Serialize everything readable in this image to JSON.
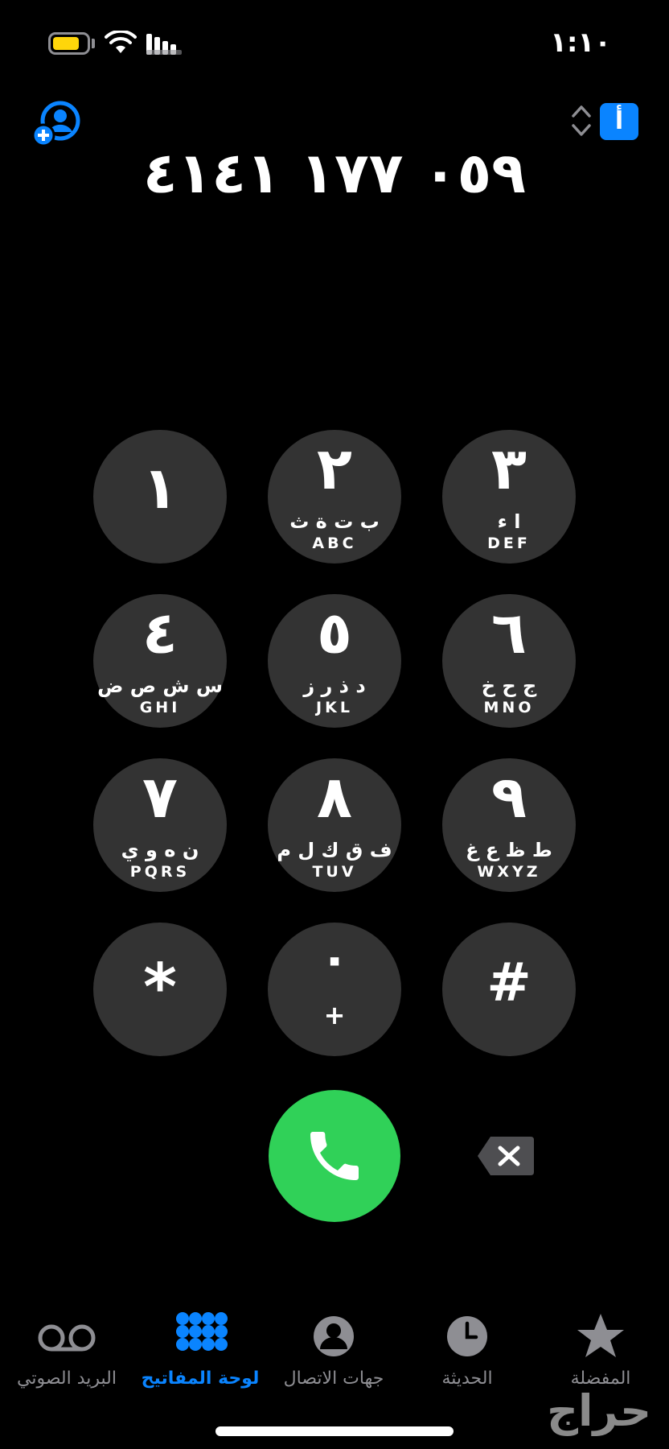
{
  "status_bar": {
    "time": "١:١٠",
    "battery_level": 0.8,
    "battery_color": "#ffd60a"
  },
  "header": {
    "add_contact_icon": "person-plus-icon",
    "keyboard_toggle_icon": "chevron-up-down-icon",
    "language_badge": "أ",
    "dialed_number": "٠٥٩ ١٧٧ ٤١٤١"
  },
  "keypad": {
    "keys": [
      {
        "digit": "١",
        "arabic": "",
        "latin": ""
      },
      {
        "digit": "٢",
        "arabic": "ب ت ة ث",
        "latin": "ABC"
      },
      {
        "digit": "٣",
        "arabic": "ا ء",
        "latin": "DEF"
      },
      {
        "digit": "٤",
        "arabic": "س ش ص ض",
        "latin": "GHI"
      },
      {
        "digit": "٥",
        "arabic": "د ذ ر ز",
        "latin": "JKL"
      },
      {
        "digit": "٦",
        "arabic": "ج ح خ",
        "latin": "MNO"
      },
      {
        "digit": "٧",
        "arabic": "ن ه و ي",
        "latin": "PQRS"
      },
      {
        "digit": "٨",
        "arabic": "ف ق ك ل م",
        "latin": "TUV"
      },
      {
        "digit": "٩",
        "arabic": "ط ظ ع غ",
        "latin": "WXYZ"
      },
      {
        "digit": "*",
        "arabic": "",
        "latin": ""
      },
      {
        "digit": "٠",
        "arabic": "",
        "latin": "+"
      },
      {
        "digit": "#",
        "arabic": "",
        "latin": ""
      }
    ]
  },
  "actions": {
    "call_icon": "phone-icon",
    "backspace_icon": "delete-left-icon"
  },
  "tab_bar": {
    "tabs": [
      {
        "label": "البريد الصوتي",
        "icon": "voicemail-icon",
        "active": false
      },
      {
        "label": "لوحة المفاتيح",
        "icon": "keypad-icon",
        "active": true
      },
      {
        "label": "جهات الاتصال",
        "icon": "contacts-icon",
        "active": false
      },
      {
        "label": "الحديثة",
        "icon": "clock-icon",
        "active": false
      },
      {
        "label": "المفضلة",
        "icon": "star-icon",
        "active": false
      }
    ]
  },
  "watermark": "حراج",
  "colors": {
    "accent": "#0a84ff",
    "call_green": "#30d158",
    "key_background": "#333333",
    "inactive_gray": "#8e8e93"
  }
}
